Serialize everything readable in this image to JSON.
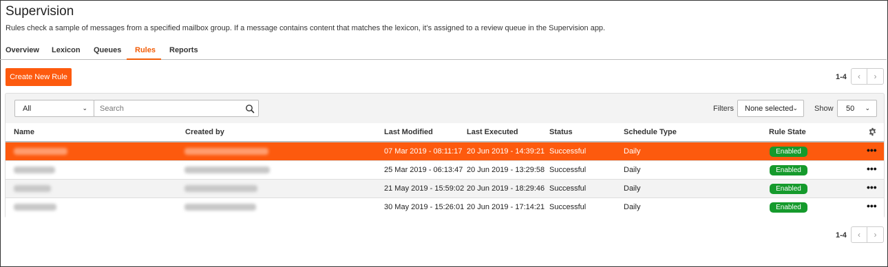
{
  "page": {
    "title": "Supervision",
    "description": "Rules check a sample of messages from a specified mailbox group. If a message contains content that matches the lexicon, it’s assigned to a review queue in the Supervision app."
  },
  "tabs": [
    {
      "label": "Overview",
      "active": false
    },
    {
      "label": "Lexicon",
      "active": false
    },
    {
      "label": "Queues",
      "active": false
    },
    {
      "label": "Rules",
      "active": true
    },
    {
      "label": "Reports",
      "active": false
    }
  ],
  "toolbar": {
    "create_label": "Create New Rule",
    "pager_top": "1-4",
    "pager_bottom": "1-4",
    "prev_glyph": "‹",
    "next_glyph": "›"
  },
  "filter_bar": {
    "scope_value": "All",
    "search_placeholder": "Search",
    "filters_label": "Filters",
    "filters_value": "None selected",
    "show_label": "Show",
    "show_value": "50",
    "chevron_glyph": "⌄"
  },
  "table": {
    "columns": [
      "Name",
      "Created by",
      "Last Modified",
      "Last Executed",
      "Status",
      "Schedule Type",
      "Rule State"
    ],
    "rows": [
      {
        "last_modified": "07 Mar 2019 - 08:11:17",
        "last_executed": "20 Jun 2019 - 14:39:21",
        "status": "Successful",
        "schedule": "Daily",
        "state": "Enabled",
        "selected": true
      },
      {
        "last_modified": "25 Mar 2019 - 06:13:47",
        "last_executed": "20 Jun 2019 - 13:29:58",
        "status": "Successful",
        "schedule": "Daily",
        "state": "Enabled",
        "selected": false
      },
      {
        "last_modified": "21 May 2019 - 15:59:02",
        "last_executed": "20 Jun 2019 - 18:29:46",
        "status": "Successful",
        "schedule": "Daily",
        "state": "Enabled",
        "selected": false
      },
      {
        "last_modified": "30 May 2019 - 15:26:01",
        "last_executed": "20 Jun 2019 - 17:14:21",
        "status": "Successful",
        "schedule": "Daily",
        "state": "Enabled",
        "selected": false
      }
    ],
    "more_glyph": "•••"
  },
  "colors": {
    "accent": "#fd5a0e",
    "enabled_badge": "#159a2c"
  },
  "icons": [
    "search-icon",
    "gear-icon",
    "more-icon",
    "chevron-down-icon",
    "chevron-left-icon",
    "chevron-right-icon"
  ]
}
